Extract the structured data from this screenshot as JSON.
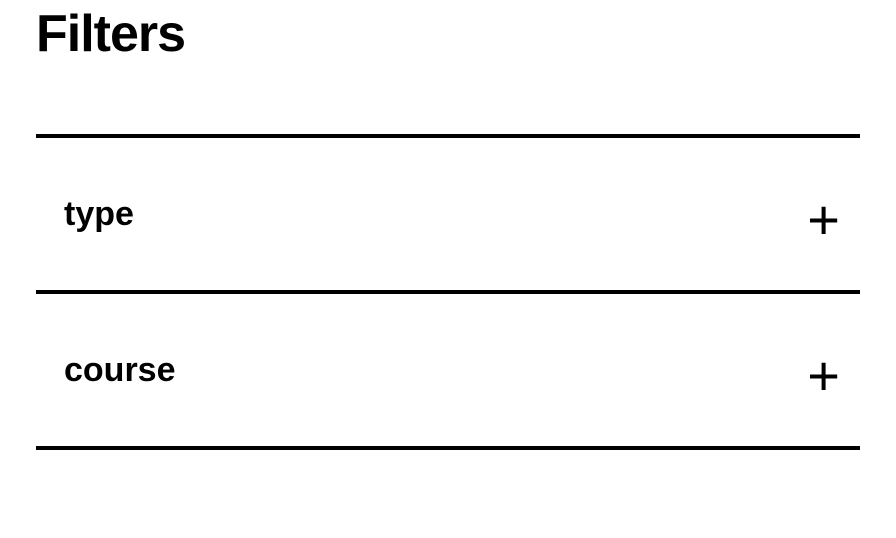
{
  "title": "Filters",
  "filters": [
    {
      "label": "type",
      "icon": "+"
    },
    {
      "label": "course",
      "icon": "+"
    }
  ]
}
